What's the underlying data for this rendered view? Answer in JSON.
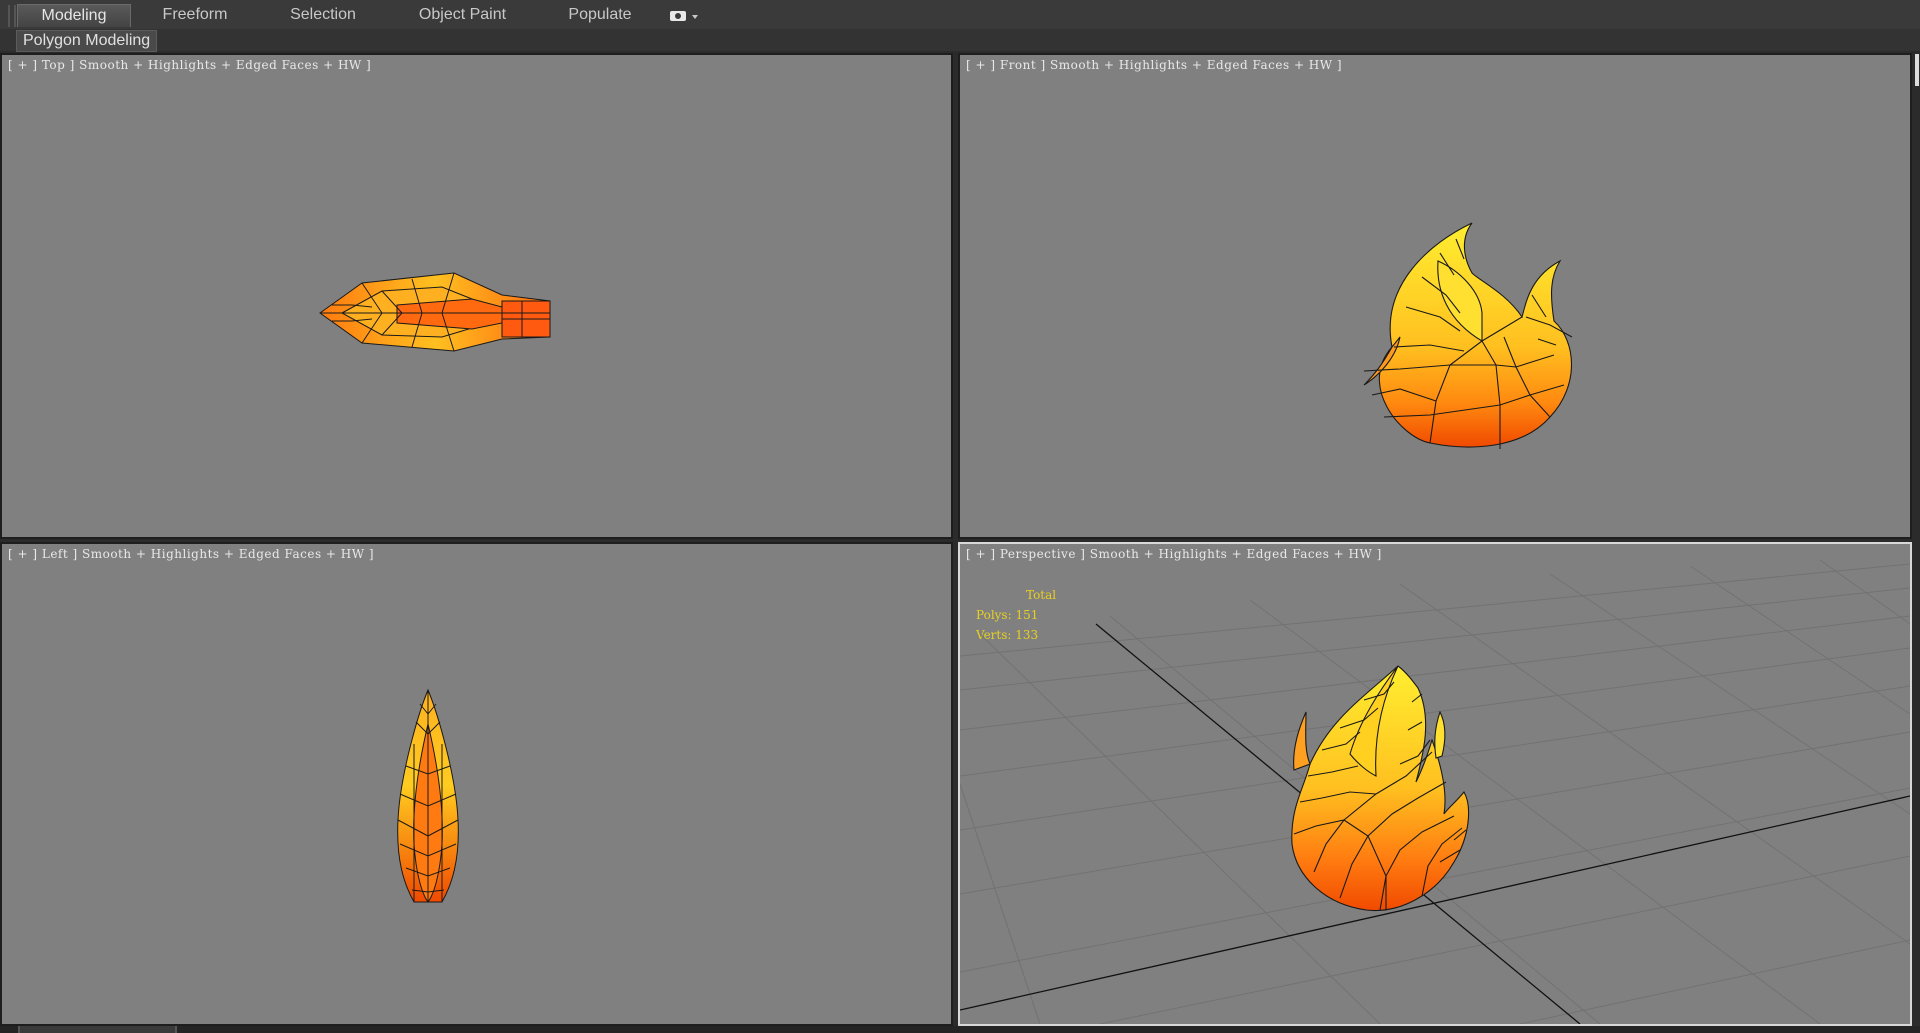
{
  "ribbon": {
    "tabs": [
      "Modeling",
      "Freeform",
      "Selection",
      "Object Paint",
      "Populate"
    ],
    "active_tab": "Modeling",
    "menu_icon": "camera-dropdown-icon"
  },
  "subbar": {
    "label": "Polygon Modeling"
  },
  "viewports": {
    "top": {
      "label": "[ + ] Top ] Smooth + Highlights + Edged Faces + HW ]"
    },
    "front": {
      "label": "[ + ] Front ] Smooth + Highlights + Edged Faces + HW ]"
    },
    "left": {
      "label": "[ + ] Left ] Smooth + Highlights + Edged Faces + HW ]"
    },
    "perspective": {
      "label": "[ + ] Perspective ] Smooth + Highlights + Edged Faces + HW ]"
    }
  },
  "stats": {
    "total": "Total",
    "polys": "Polys: 151",
    "verts": "Verts: 133"
  },
  "colors": {
    "viewport_bg": "#808080",
    "flame_yellow": "#ffe020",
    "flame_orange": "#ff7a10",
    "flame_red": "#e83a00",
    "stats_text": "#e8d020"
  }
}
